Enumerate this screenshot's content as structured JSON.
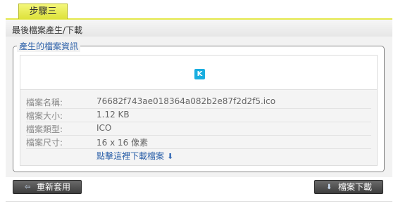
{
  "step": {
    "label": "步驟三"
  },
  "header": {
    "title": "最後檔案產生/下載"
  },
  "file_info": {
    "legend": "產生的檔案資訊",
    "icon_letter": "K",
    "rows": [
      {
        "label": "檔案名稱:",
        "value": "76682f743ae018364a082b2e87f2d2f5.ico"
      },
      {
        "label": "檔案大小:",
        "value": "1.12 KB"
      },
      {
        "label": "檔案類型:",
        "value": "ICO"
      },
      {
        "label": "檔案尺寸:",
        "value": "16 x 16 像素"
      }
    ],
    "download_link": "點擊這裡下載檔案"
  },
  "buttons": {
    "back": "重新套用",
    "download": "檔案下載"
  },
  "colors": {
    "tab_yellow": "#e8ec55",
    "link_blue": "#2a5fa8",
    "icon_cyan": "#19aee0",
    "button_dark": "#4a4a4a"
  }
}
